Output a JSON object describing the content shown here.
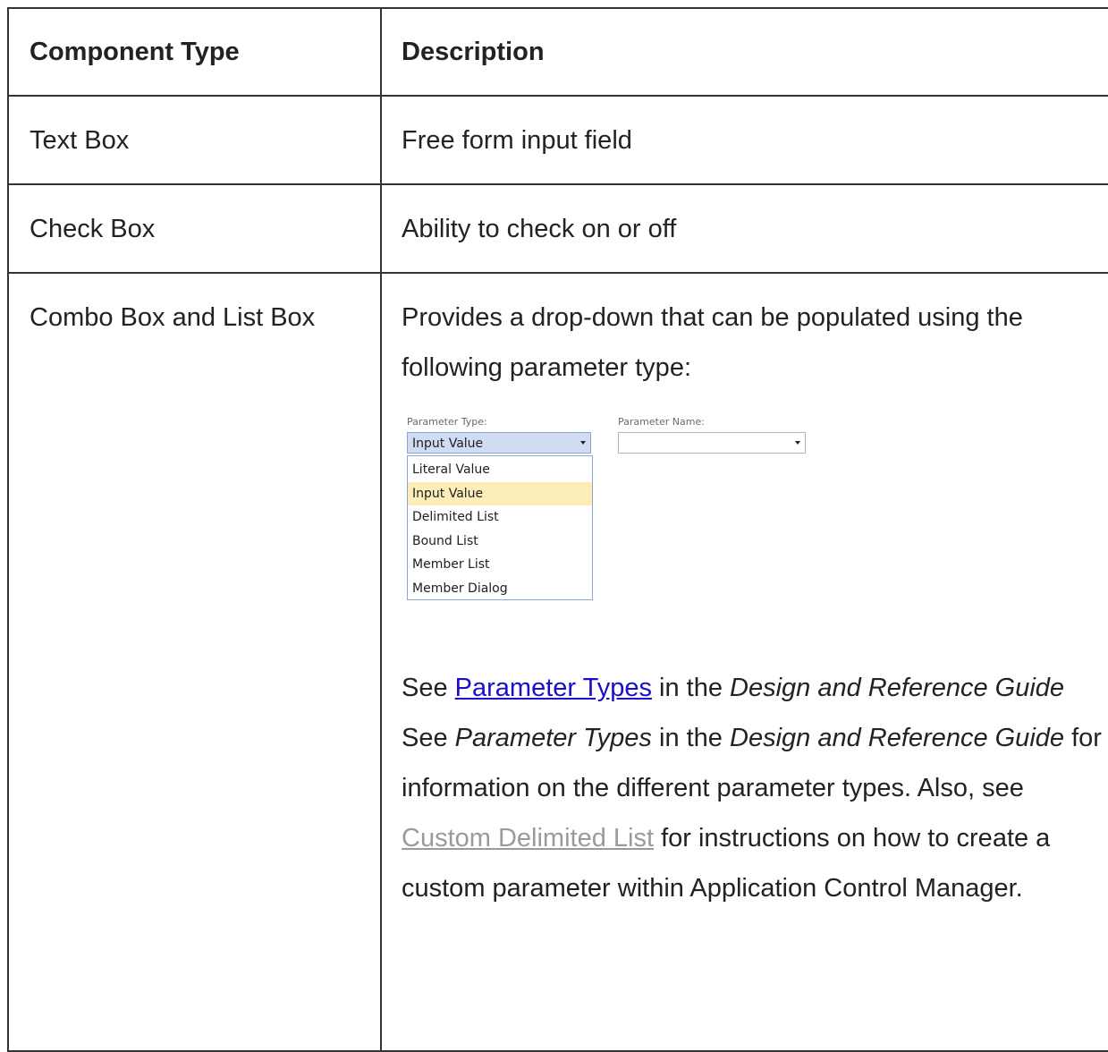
{
  "table": {
    "headers": [
      "Component Type",
      "Description"
    ],
    "rows": [
      {
        "component": "Text Box",
        "description": "Free form input field"
      },
      {
        "component": "Check Box",
        "description": "Ability to check on or off"
      },
      {
        "component": "Combo Box and List Box",
        "description_intro": "Provides a drop-down that can be populated using the following parameter type:",
        "note": {
          "see_1": "See ",
          "link_parameter_types": "Parameter Types",
          "in_the_1": " in the ",
          "guide_italic_1": "Design and Reference Guide",
          "see_2": " See ",
          "parameter_types_italic": "Parameter Types",
          "in_the_2": " in the ",
          "guide_italic_2": "Design and Reference Guide",
          "for_info": " for information on the different parameter types. Also, see ",
          "link_custom_delimited": "Custom Delimited List",
          "for_instructions": " for instructions on how to create a custom parameter within Application Control Manager."
        }
      }
    ]
  },
  "parameter_dialog": {
    "parameter_type_label": "Parameter Type:",
    "parameter_type_value": "Input Value",
    "parameter_name_label": "Parameter Name:",
    "parameter_name_value": "",
    "options": [
      "Literal Value",
      "Input Value",
      "Delimited List",
      "Bound List",
      "Member List",
      "Member Dialog"
    ],
    "selected_option": "Input Value",
    "colors": {
      "select_bg": "#cfdcf4",
      "highlight": "#fcedb9",
      "border": "#8aa7d6"
    }
  },
  "colors": {
    "link_primary": "#1a0dcc",
    "link_muted": "#9a9a9a",
    "border": "#333333",
    "text": "#222222"
  }
}
